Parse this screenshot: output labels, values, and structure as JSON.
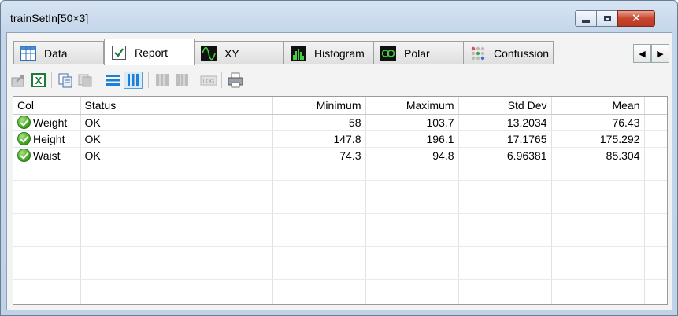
{
  "window": {
    "title": "trainSetIn[50×3]"
  },
  "titlebar_buttons": {
    "minimize": "minimize",
    "maximize": "maximize",
    "close": "close"
  },
  "tabs": [
    {
      "label": "Data",
      "icon": "table-icon",
      "active": false
    },
    {
      "label": "Report",
      "icon": "checkbox-icon",
      "active": true
    },
    {
      "label": "XY",
      "icon": "sine-wave-icon",
      "active": false
    },
    {
      "label": "Histogram",
      "icon": "histogram-icon",
      "active": false
    },
    {
      "label": "Polar",
      "icon": "polar-icon",
      "active": false
    },
    {
      "label": "Confussion",
      "icon": "confusion-matrix-icon",
      "active": false
    }
  ],
  "tab_scroll": {
    "left": "◀",
    "right": "▶"
  },
  "toolbar": {
    "buttons": [
      "export-icon",
      "excel-icon",
      "copy-icon",
      "copy-chart-icon",
      "list-view-icon",
      "column-view-icon",
      "bar-icon",
      "bar-icon",
      "log-icon",
      "print-icon"
    ]
  },
  "grid": {
    "columns": [
      "Col",
      "Status",
      "Minimum",
      "Maximum",
      "Std Dev",
      "Mean"
    ],
    "rows": [
      {
        "col": "Weight",
        "status": "OK",
        "minimum": "58",
        "maximum": "103.7",
        "std_dev": "13.2034",
        "mean": "76.43"
      },
      {
        "col": "Height",
        "status": "OK",
        "minimum": "147.8",
        "maximum": "196.1",
        "std_dev": "17.1765",
        "mean": "175.292"
      },
      {
        "col": "Waist",
        "status": "OK",
        "minimum": "74.3",
        "maximum": "94.8",
        "std_dev": "6.96381",
        "mean": "85.304"
      }
    ]
  },
  "colors": {
    "accent": "#0078d7",
    "close_button": "#c7452d",
    "ok_green": "#3b9c1f"
  }
}
